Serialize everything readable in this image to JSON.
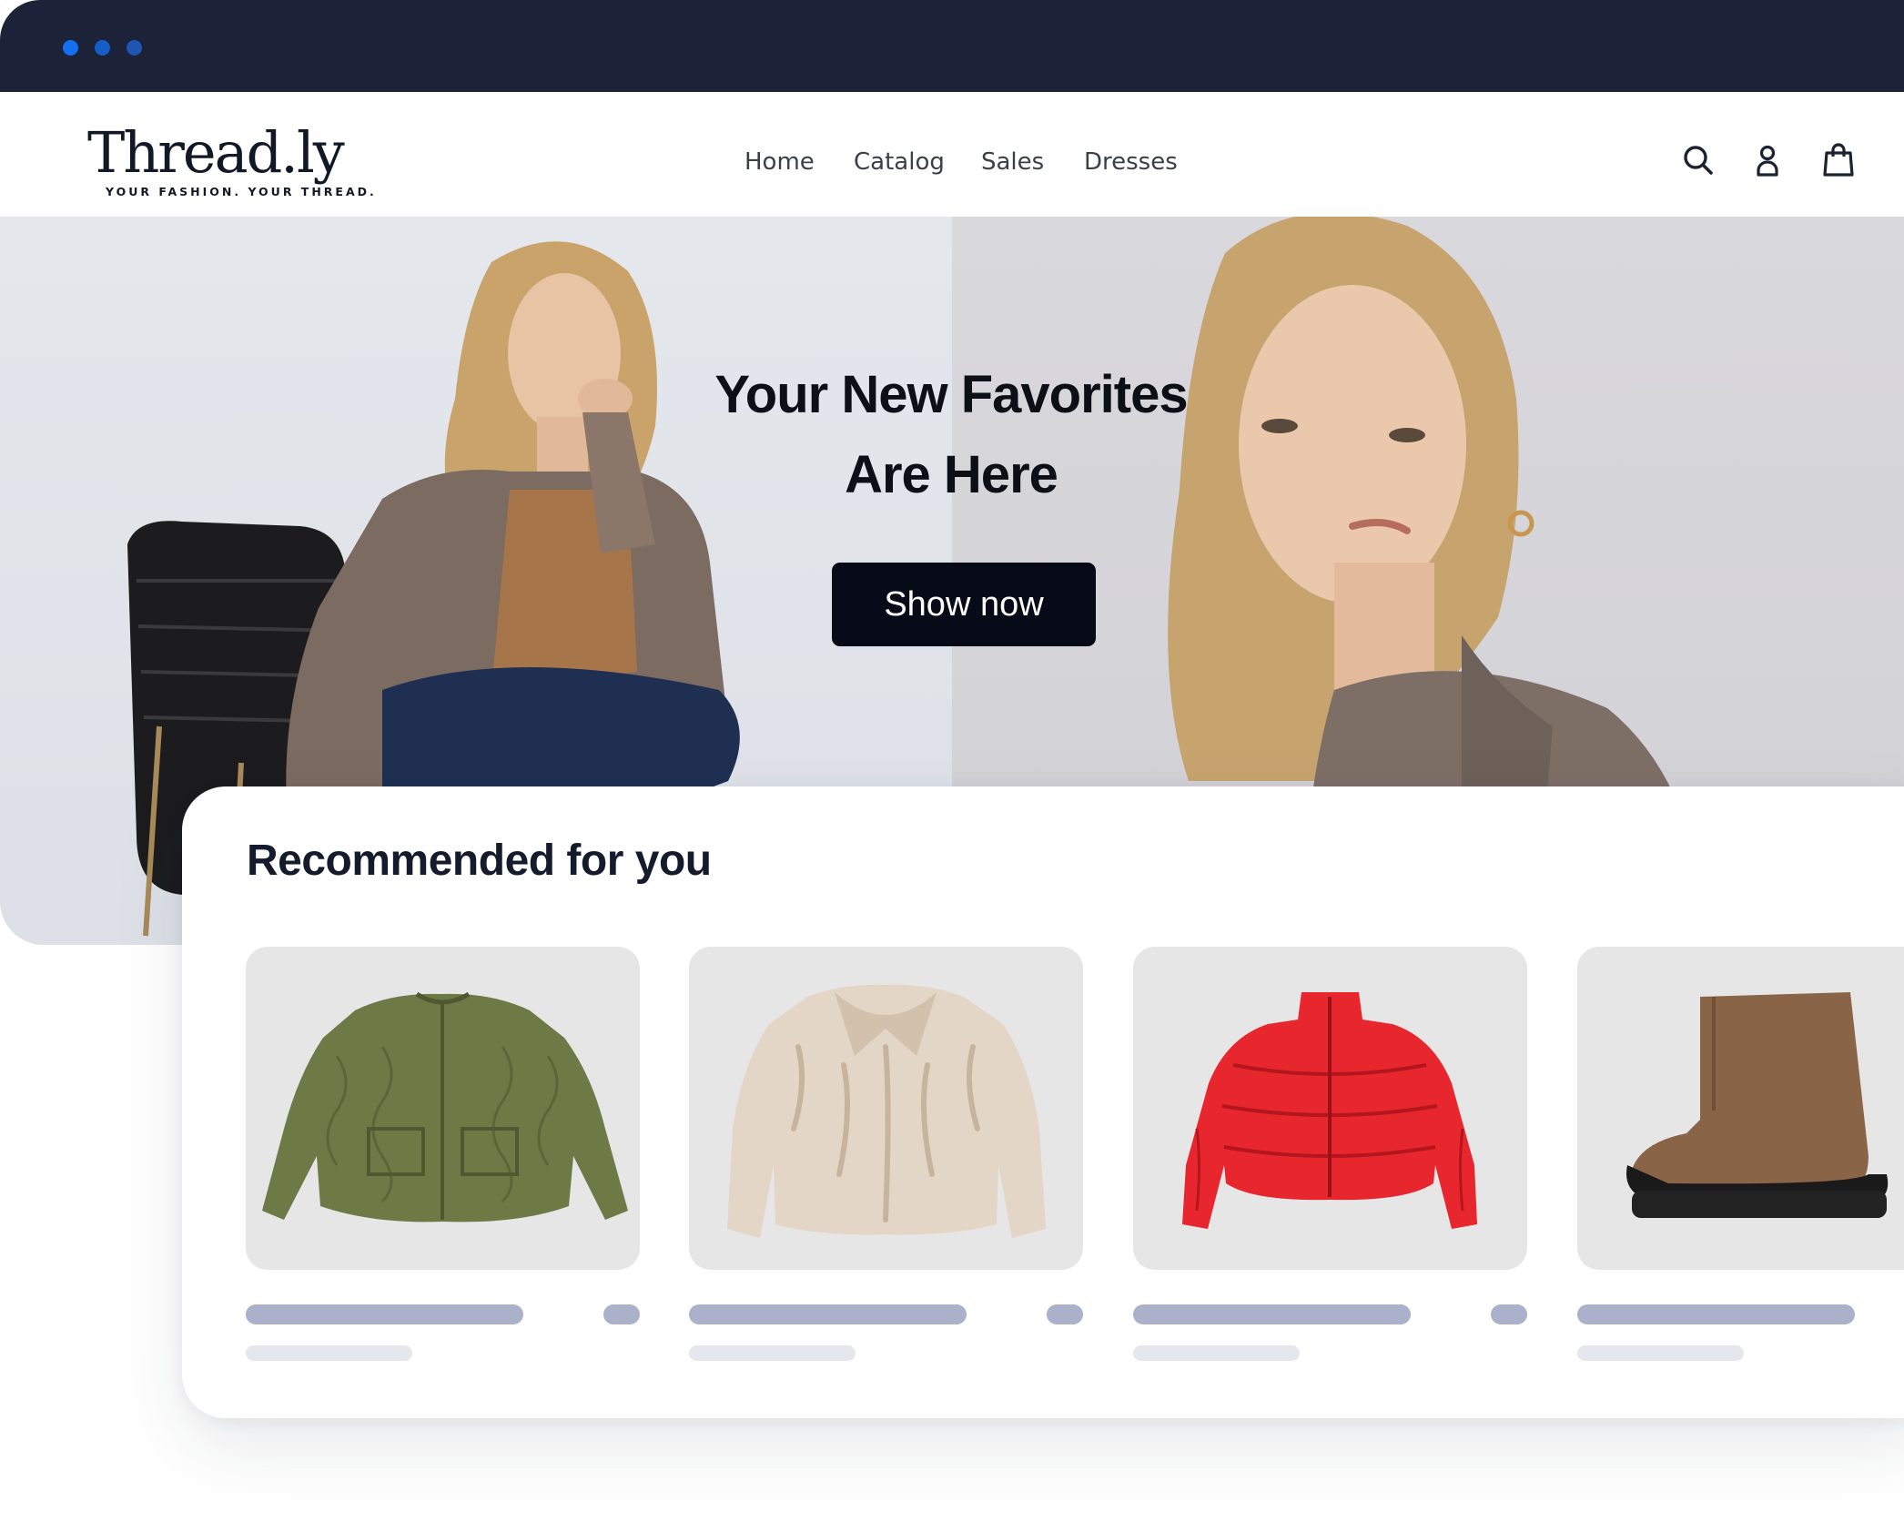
{
  "window": {
    "dots": [
      "#1570ef",
      "#155ec6",
      "#1f55b3"
    ]
  },
  "header": {
    "logo_word": "Thread.ly",
    "logo_tagline": "YOUR FASHION. YOUR THREAD.",
    "nav": [
      {
        "label": "Home"
      },
      {
        "label": "Catalog"
      },
      {
        "label": "Sales"
      },
      {
        "label": "Dresses"
      }
    ],
    "icons": [
      "search-icon",
      "user-icon",
      "shopping-bag-icon"
    ]
  },
  "hero": {
    "title_line1": "Your New Favorites",
    "title_line2": "Are Here",
    "cta_label": "Show now"
  },
  "recommended": {
    "title": "Recommended for you",
    "products": [
      {
        "image": "green-quilted-jacket"
      },
      {
        "image": "faux-fur-jacket"
      },
      {
        "image": "red-puffer-jacket"
      },
      {
        "image": "brown-suede-boot"
      }
    ]
  },
  "colors": {
    "titlebar": "#1c2237",
    "cta_bg": "#070b18",
    "skeleton_primary": "#abb1ca",
    "skeleton_secondary": "#e6e7ec"
  }
}
